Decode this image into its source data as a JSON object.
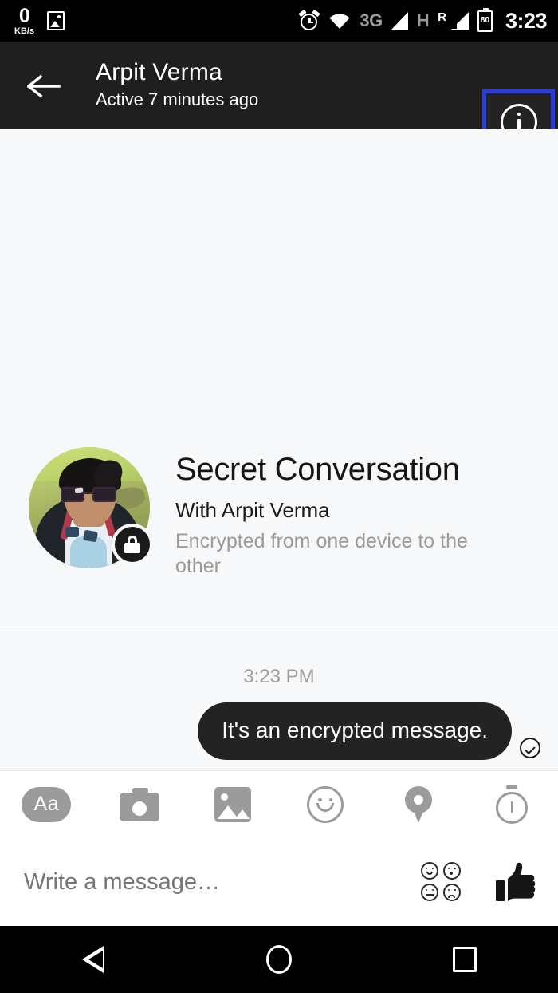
{
  "status_bar": {
    "net_speed_value": "0",
    "net_speed_unit": "KB/s",
    "icons": [
      "image-icon",
      "alarm-icon",
      "wifi-icon",
      "signal-3g-icon",
      "signal-h-roaming-icon",
      "battery-icon"
    ],
    "network_label": "3G",
    "network_label_2": "H",
    "roaming_label": "R",
    "battery_level": "80",
    "time": "3:23"
  },
  "header": {
    "back_label": "back-arrow",
    "contact_name": "Arpit Verma",
    "active_status": "Active 7 minutes ago",
    "info_button_label": "info-icon",
    "highlight_color": "#2b3ce0"
  },
  "secret_conversation": {
    "title": "Secret Conversation",
    "with_line": "With Arpit Verma",
    "description": "Encrypted from one device to the other",
    "lock_badge": "lock-icon"
  },
  "conversation": {
    "timestamp": "3:23 PM",
    "messages": [
      {
        "text": "It's an encrypted message.",
        "side": "outgoing",
        "status": "delivered",
        "bubble_color": "#232323",
        "text_color": "#ffffff"
      }
    ]
  },
  "composer": {
    "tools": [
      {
        "name": "text-format-icon",
        "label": "Aa"
      },
      {
        "name": "camera-icon",
        "label": ""
      },
      {
        "name": "gallery-icon",
        "label": ""
      },
      {
        "name": "emoji-icon",
        "label": ""
      },
      {
        "name": "location-icon",
        "label": ""
      },
      {
        "name": "disappearing-timer-icon",
        "label": ""
      }
    ],
    "input_placeholder": "Write a message…",
    "input_value": "",
    "sticker_button": "sticker-icon",
    "like_button": "thumbs-up-icon"
  },
  "navigation_bar": {
    "back": "nav-back-triangle",
    "home": "nav-home-circle",
    "recents": "nav-recents-square"
  }
}
